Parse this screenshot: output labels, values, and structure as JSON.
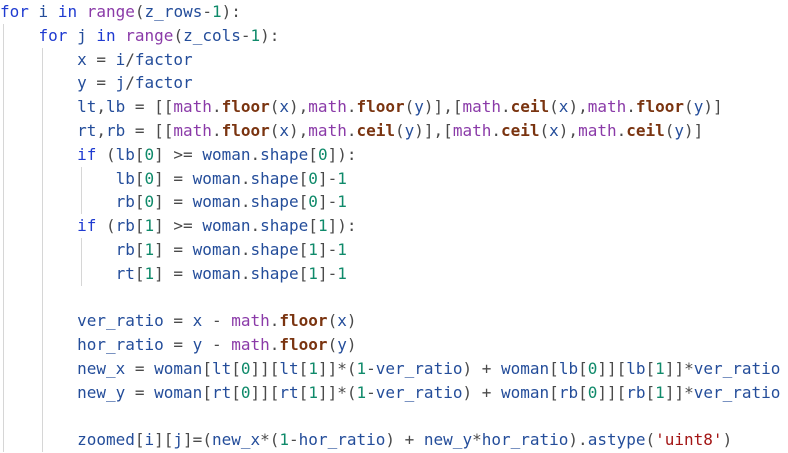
{
  "code": {
    "language": "python",
    "indent_unit": "    ",
    "lines": [
      {
        "indent": 0,
        "tokens": [
          [
            "kw",
            "for"
          ],
          [
            "pn",
            " "
          ],
          [
            "id",
            "i"
          ],
          [
            "pn",
            " "
          ],
          [
            "kw",
            "in"
          ],
          [
            "pn",
            " "
          ],
          [
            "bi",
            "range"
          ],
          [
            "pn",
            "("
          ],
          [
            "id",
            "z_rows"
          ],
          [
            "pn",
            "-"
          ],
          [
            "nm",
            "1"
          ],
          [
            "pn",
            "):"
          ]
        ]
      },
      {
        "indent": 1,
        "tokens": [
          [
            "kw",
            "for"
          ],
          [
            "pn",
            " "
          ],
          [
            "id",
            "j"
          ],
          [
            "pn",
            " "
          ],
          [
            "kw",
            "in"
          ],
          [
            "pn",
            " "
          ],
          [
            "bi",
            "range"
          ],
          [
            "pn",
            "("
          ],
          [
            "id",
            "z_cols"
          ],
          [
            "pn",
            "-"
          ],
          [
            "nm",
            "1"
          ],
          [
            "pn",
            "):"
          ]
        ]
      },
      {
        "indent": 2,
        "tokens": [
          [
            "id",
            "x"
          ],
          [
            "pn",
            " = "
          ],
          [
            "id",
            "i"
          ],
          [
            "pn",
            "/"
          ],
          [
            "id",
            "factor"
          ]
        ]
      },
      {
        "indent": 2,
        "tokens": [
          [
            "id",
            "y"
          ],
          [
            "pn",
            " = "
          ],
          [
            "id",
            "j"
          ],
          [
            "pn",
            "/"
          ],
          [
            "id",
            "factor"
          ]
        ]
      },
      {
        "indent": 2,
        "tokens": [
          [
            "id",
            "lt"
          ],
          [
            "pn",
            ","
          ],
          [
            "id",
            "lb"
          ],
          [
            "pn",
            " = [["
          ],
          [
            "bi",
            "math"
          ],
          [
            "pn",
            "."
          ],
          [
            "fn",
            "floor"
          ],
          [
            "pn",
            "("
          ],
          [
            "id",
            "x"
          ],
          [
            "pn",
            "),"
          ],
          [
            "bi",
            "math"
          ],
          [
            "pn",
            "."
          ],
          [
            "fn",
            "floor"
          ],
          [
            "pn",
            "("
          ],
          [
            "id",
            "y"
          ],
          [
            "pn",
            ")],["
          ],
          [
            "bi",
            "math"
          ],
          [
            "pn",
            "."
          ],
          [
            "fn",
            "ceil"
          ],
          [
            "pn",
            "("
          ],
          [
            "id",
            "x"
          ],
          [
            "pn",
            "),"
          ],
          [
            "bi",
            "math"
          ],
          [
            "pn",
            "."
          ],
          [
            "fn",
            "floor"
          ],
          [
            "pn",
            "("
          ],
          [
            "id",
            "y"
          ],
          [
            "pn",
            ")]"
          ]
        ]
      },
      {
        "indent": 2,
        "tokens": [
          [
            "id",
            "rt"
          ],
          [
            "pn",
            ","
          ],
          [
            "id",
            "rb"
          ],
          [
            "pn",
            " = [["
          ],
          [
            "bi",
            "math"
          ],
          [
            "pn",
            "."
          ],
          [
            "fn",
            "floor"
          ],
          [
            "pn",
            "("
          ],
          [
            "id",
            "x"
          ],
          [
            "pn",
            "),"
          ],
          [
            "bi",
            "math"
          ],
          [
            "pn",
            "."
          ],
          [
            "fn",
            "ceil"
          ],
          [
            "pn",
            "("
          ],
          [
            "id",
            "y"
          ],
          [
            "pn",
            ")],["
          ],
          [
            "bi",
            "math"
          ],
          [
            "pn",
            "."
          ],
          [
            "fn",
            "ceil"
          ],
          [
            "pn",
            "("
          ],
          [
            "id",
            "x"
          ],
          [
            "pn",
            "),"
          ],
          [
            "bi",
            "math"
          ],
          [
            "pn",
            "."
          ],
          [
            "fn",
            "ceil"
          ],
          [
            "pn",
            "("
          ],
          [
            "id",
            "y"
          ],
          [
            "pn",
            ")]"
          ]
        ]
      },
      {
        "indent": 2,
        "tokens": [
          [
            "kw",
            "if"
          ],
          [
            "pn",
            " ("
          ],
          [
            "id",
            "lb"
          ],
          [
            "pn",
            "["
          ],
          [
            "nm",
            "0"
          ],
          [
            "pn",
            "] >= "
          ],
          [
            "id",
            "woman"
          ],
          [
            "pn",
            "."
          ],
          [
            "id",
            "shape"
          ],
          [
            "pn",
            "["
          ],
          [
            "nm",
            "0"
          ],
          [
            "pn",
            "]):"
          ]
        ]
      },
      {
        "indent": 3,
        "tokens": [
          [
            "id",
            "lb"
          ],
          [
            "pn",
            "["
          ],
          [
            "nm",
            "0"
          ],
          [
            "pn",
            "] = "
          ],
          [
            "id",
            "woman"
          ],
          [
            "pn",
            "."
          ],
          [
            "id",
            "shape"
          ],
          [
            "pn",
            "["
          ],
          [
            "nm",
            "0"
          ],
          [
            "pn",
            "]-"
          ],
          [
            "nm",
            "1"
          ]
        ]
      },
      {
        "indent": 3,
        "tokens": [
          [
            "id",
            "rb"
          ],
          [
            "pn",
            "["
          ],
          [
            "nm",
            "0"
          ],
          [
            "pn",
            "] = "
          ],
          [
            "id",
            "woman"
          ],
          [
            "pn",
            "."
          ],
          [
            "id",
            "shape"
          ],
          [
            "pn",
            "["
          ],
          [
            "nm",
            "0"
          ],
          [
            "pn",
            "]-"
          ],
          [
            "nm",
            "1"
          ]
        ]
      },
      {
        "indent": 2,
        "tokens": [
          [
            "kw",
            "if"
          ],
          [
            "pn",
            " ("
          ],
          [
            "id",
            "rb"
          ],
          [
            "pn",
            "["
          ],
          [
            "nm",
            "1"
          ],
          [
            "pn",
            "] >= "
          ],
          [
            "id",
            "woman"
          ],
          [
            "pn",
            "."
          ],
          [
            "id",
            "shape"
          ],
          [
            "pn",
            "["
          ],
          [
            "nm",
            "1"
          ],
          [
            "pn",
            "]):"
          ]
        ]
      },
      {
        "indent": 3,
        "tokens": [
          [
            "id",
            "rb"
          ],
          [
            "pn",
            "["
          ],
          [
            "nm",
            "1"
          ],
          [
            "pn",
            "] = "
          ],
          [
            "id",
            "woman"
          ],
          [
            "pn",
            "."
          ],
          [
            "id",
            "shape"
          ],
          [
            "pn",
            "["
          ],
          [
            "nm",
            "1"
          ],
          [
            "pn",
            "]-"
          ],
          [
            "nm",
            "1"
          ]
        ]
      },
      {
        "indent": 3,
        "tokens": [
          [
            "id",
            "rt"
          ],
          [
            "pn",
            "["
          ],
          [
            "nm",
            "1"
          ],
          [
            "pn",
            "] = "
          ],
          [
            "id",
            "woman"
          ],
          [
            "pn",
            "."
          ],
          [
            "id",
            "shape"
          ],
          [
            "pn",
            "["
          ],
          [
            "nm",
            "1"
          ],
          [
            "pn",
            "]-"
          ],
          [
            "nm",
            "1"
          ]
        ]
      },
      {
        "indent": 2,
        "tokens": []
      },
      {
        "indent": 2,
        "tokens": [
          [
            "id",
            "ver_ratio"
          ],
          [
            "pn",
            " = "
          ],
          [
            "id",
            "x"
          ],
          [
            "pn",
            " - "
          ],
          [
            "bi",
            "math"
          ],
          [
            "pn",
            "."
          ],
          [
            "fn",
            "floor"
          ],
          [
            "pn",
            "("
          ],
          [
            "id",
            "x"
          ],
          [
            "pn",
            ")"
          ]
        ]
      },
      {
        "indent": 2,
        "tokens": [
          [
            "id",
            "hor_ratio"
          ],
          [
            "pn",
            " = "
          ],
          [
            "id",
            "y"
          ],
          [
            "pn",
            " - "
          ],
          [
            "bi",
            "math"
          ],
          [
            "pn",
            "."
          ],
          [
            "fn",
            "floor"
          ],
          [
            "pn",
            "("
          ],
          [
            "id",
            "y"
          ],
          [
            "pn",
            ")"
          ]
        ]
      },
      {
        "indent": 2,
        "tokens": [
          [
            "id",
            "new_x"
          ],
          [
            "pn",
            " = "
          ],
          [
            "id",
            "woman"
          ],
          [
            "pn",
            "["
          ],
          [
            "id",
            "lt"
          ],
          [
            "pn",
            "["
          ],
          [
            "nm",
            "0"
          ],
          [
            "pn",
            "]]["
          ],
          [
            "id",
            "lt"
          ],
          [
            "pn",
            "["
          ],
          [
            "nm",
            "1"
          ],
          [
            "pn",
            "]]*("
          ],
          [
            "nm",
            "1"
          ],
          [
            "pn",
            "-"
          ],
          [
            "id",
            "ver_ratio"
          ],
          [
            "pn",
            ") + "
          ],
          [
            "id",
            "woman"
          ],
          [
            "pn",
            "["
          ],
          [
            "id",
            "lb"
          ],
          [
            "pn",
            "["
          ],
          [
            "nm",
            "0"
          ],
          [
            "pn",
            "]]["
          ],
          [
            "id",
            "lb"
          ],
          [
            "pn",
            "["
          ],
          [
            "nm",
            "1"
          ],
          [
            "pn",
            "]]*"
          ],
          [
            "id",
            "ver_ratio"
          ]
        ]
      },
      {
        "indent": 2,
        "tokens": [
          [
            "id",
            "new_y"
          ],
          [
            "pn",
            " = "
          ],
          [
            "id",
            "woman"
          ],
          [
            "pn",
            "["
          ],
          [
            "id",
            "rt"
          ],
          [
            "pn",
            "["
          ],
          [
            "nm",
            "0"
          ],
          [
            "pn",
            "]]["
          ],
          [
            "id",
            "rt"
          ],
          [
            "pn",
            "["
          ],
          [
            "nm",
            "1"
          ],
          [
            "pn",
            "]]*("
          ],
          [
            "nm",
            "1"
          ],
          [
            "pn",
            "-"
          ],
          [
            "id",
            "ver_ratio"
          ],
          [
            "pn",
            ") + "
          ],
          [
            "id",
            "woman"
          ],
          [
            "pn",
            "["
          ],
          [
            "id",
            "rb"
          ],
          [
            "pn",
            "["
          ],
          [
            "nm",
            "0"
          ],
          [
            "pn",
            "]]["
          ],
          [
            "id",
            "rb"
          ],
          [
            "pn",
            "["
          ],
          [
            "nm",
            "1"
          ],
          [
            "pn",
            "]]*"
          ],
          [
            "id",
            "ver_ratio"
          ]
        ]
      },
      {
        "indent": 2,
        "tokens": []
      },
      {
        "indent": 2,
        "tokens": [
          [
            "id",
            "zoomed"
          ],
          [
            "pn",
            "["
          ],
          [
            "id",
            "i"
          ],
          [
            "pn",
            "]["
          ],
          [
            "id",
            "j"
          ],
          [
            "pn",
            "]=("
          ],
          [
            "id",
            "new_x"
          ],
          [
            "pn",
            "*("
          ],
          [
            "nm",
            "1"
          ],
          [
            "pn",
            "-"
          ],
          [
            "id",
            "hor_ratio"
          ],
          [
            "pn",
            ") + "
          ],
          [
            "id",
            "new_y"
          ],
          [
            "pn",
            "*"
          ],
          [
            "id",
            "hor_ratio"
          ],
          [
            "pn",
            ")."
          ],
          [
            "id",
            "astype"
          ],
          [
            "pn",
            "("
          ],
          [
            "st",
            "'uint8'"
          ],
          [
            "pn",
            ")"
          ]
        ]
      }
    ]
  },
  "colors": {
    "background": "#ffffff",
    "keyword": "#1f3bd1",
    "builtin": "#8a3aa8",
    "function": "#7a3410",
    "number": "#0f8a6a",
    "string": "#a31515",
    "identifier": "#244d9a",
    "punctuation": "#4a4a4a",
    "indent_guide": "#d6d6d6"
  }
}
